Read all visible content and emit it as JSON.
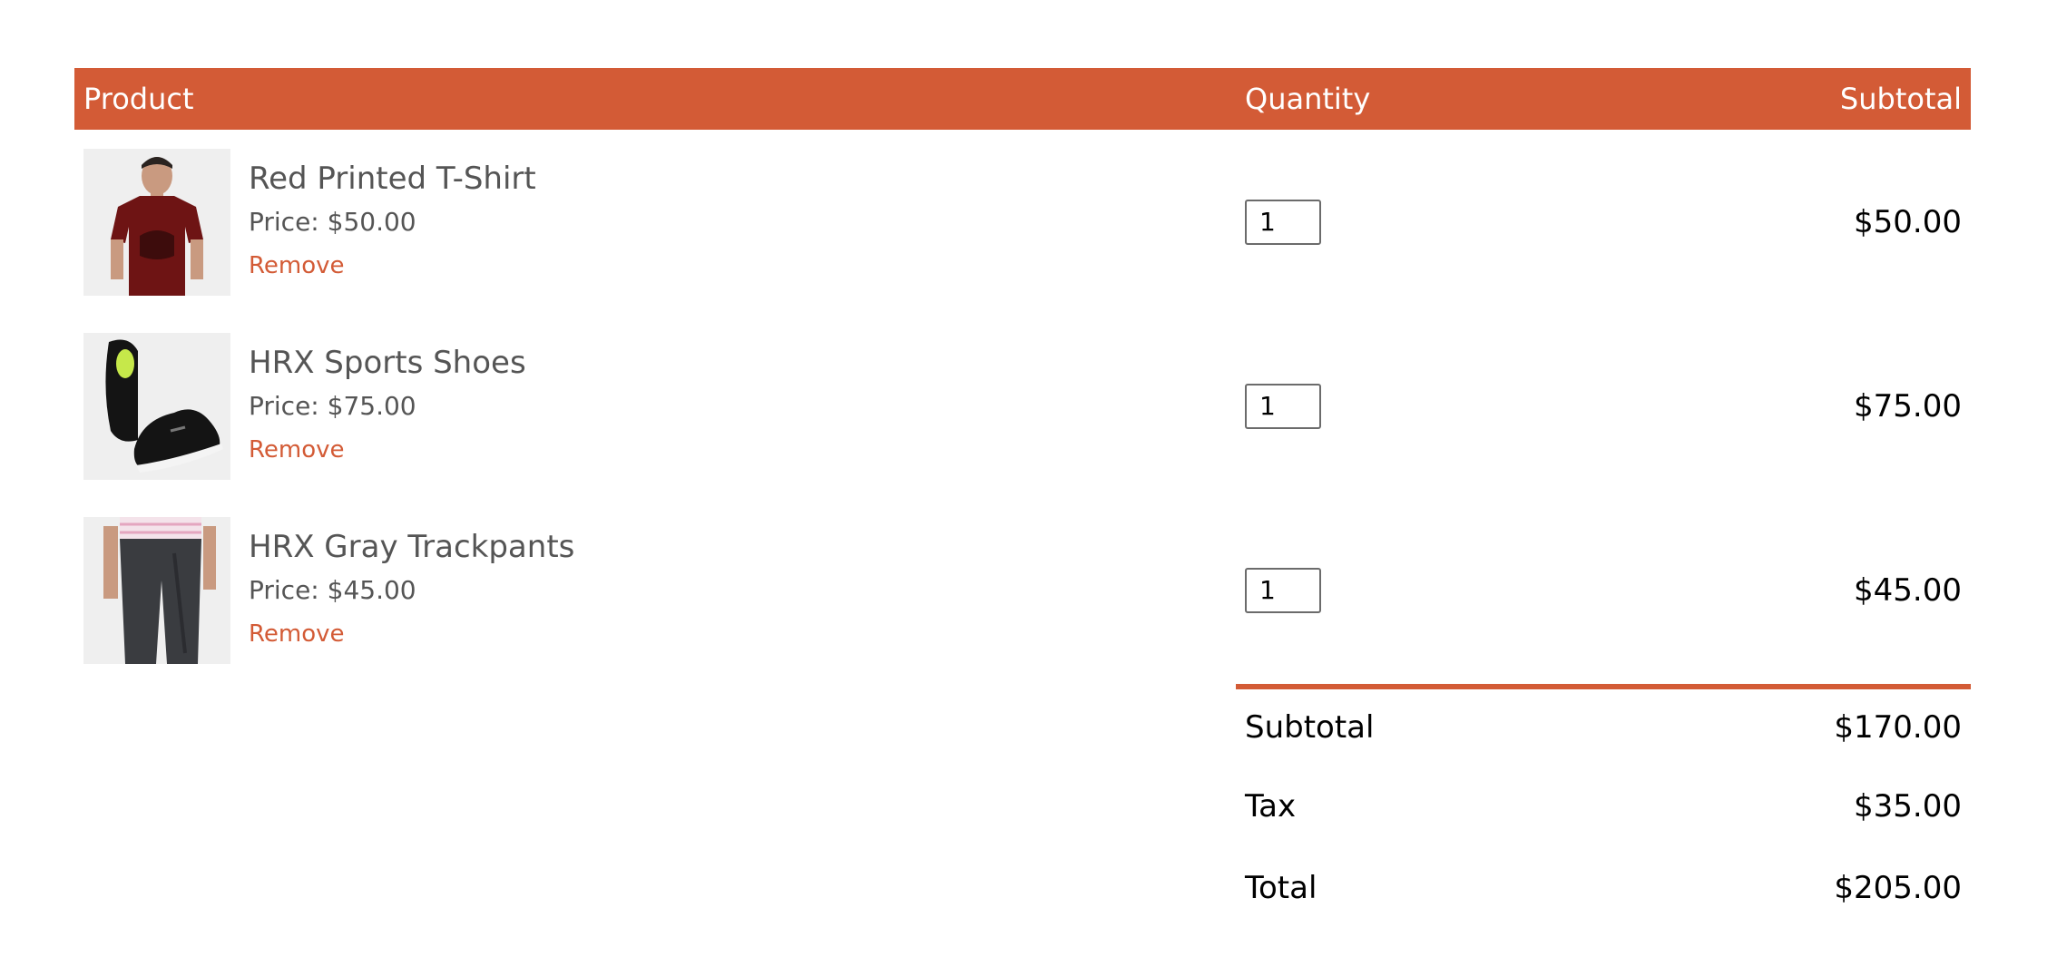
{
  "header": {
    "product": "Product",
    "quantity": "Quantity",
    "subtotal": "Subtotal"
  },
  "items": [
    {
      "name": "Red Printed T-Shirt",
      "price": "Price: $50.00",
      "remove": "Remove",
      "quantity": "1",
      "subtotal": "$50.00",
      "icon": "tshirt-product-image"
    },
    {
      "name": "HRX Sports Shoes",
      "price": "Price: $75.00",
      "remove": "Remove",
      "quantity": "1",
      "subtotal": "$75.00",
      "icon": "shoes-product-image"
    },
    {
      "name": "HRX Gray Trackpants",
      "price": "Price: $45.00",
      "remove": "Remove",
      "quantity": "1",
      "subtotal": "$45.00",
      "icon": "trackpants-product-image"
    }
  ],
  "totals": {
    "subtotal_label": "Subtotal",
    "subtotal_value": "$170.00",
    "tax_label": "Tax",
    "tax_value": "$35.00",
    "total_label": "Total",
    "total_value": "$205.00"
  },
  "colors": {
    "accent": "#d35b36",
    "text_muted": "#555555",
    "thumb_bg": "#efefef"
  }
}
